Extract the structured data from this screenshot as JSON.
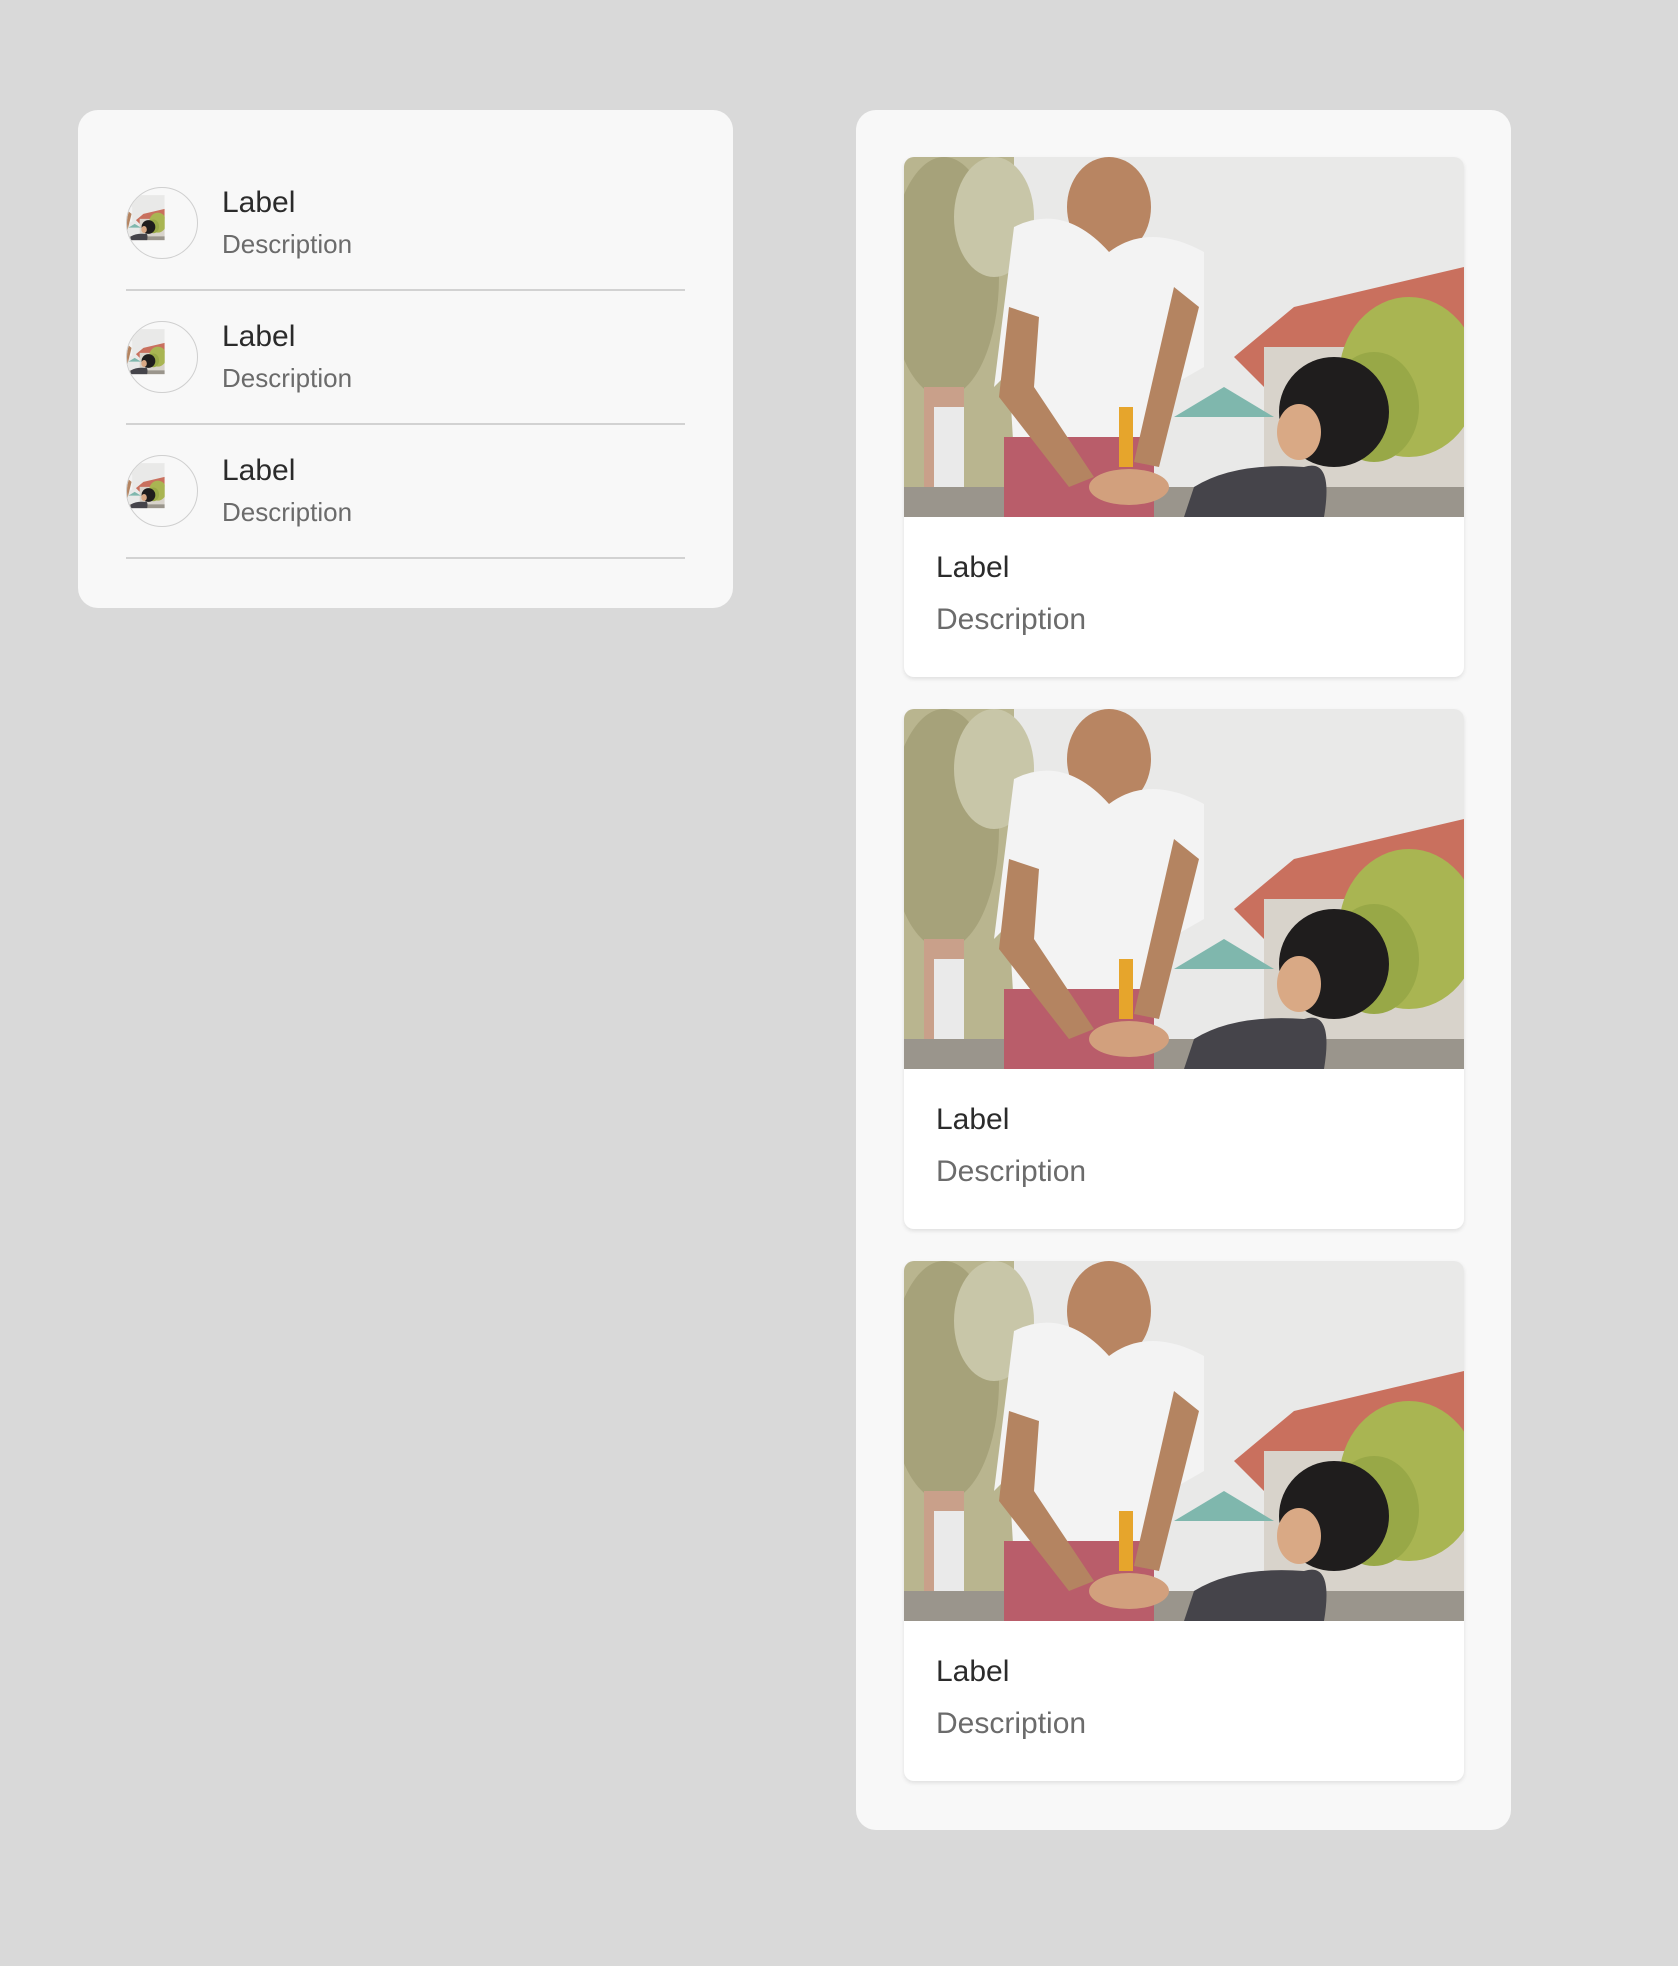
{
  "list_panel": {
    "items": [
      {
        "label": "Label",
        "description": "Description",
        "avatar": "avatar-photo"
      },
      {
        "label": "Label",
        "description": "Description",
        "avatar": "avatar-photo"
      },
      {
        "label": "Label",
        "description": "Description",
        "avatar": "avatar-photo"
      }
    ]
  },
  "card_panel": {
    "cards": [
      {
        "label": "Label",
        "description": "Description",
        "image": "photo-man-and-child"
      },
      {
        "label": "Label",
        "description": "Description",
        "image": "photo-man-and-child"
      },
      {
        "label": "Label",
        "description": "Description",
        "image": "photo-man-and-child"
      }
    ]
  },
  "colors": {
    "background": "#d9d9d9",
    "panel": "#f8f8f8",
    "card": "#ffffff",
    "label_text": "#2b2b2b",
    "description_text": "#6b6b6b",
    "divider": "#d2d2d2"
  }
}
